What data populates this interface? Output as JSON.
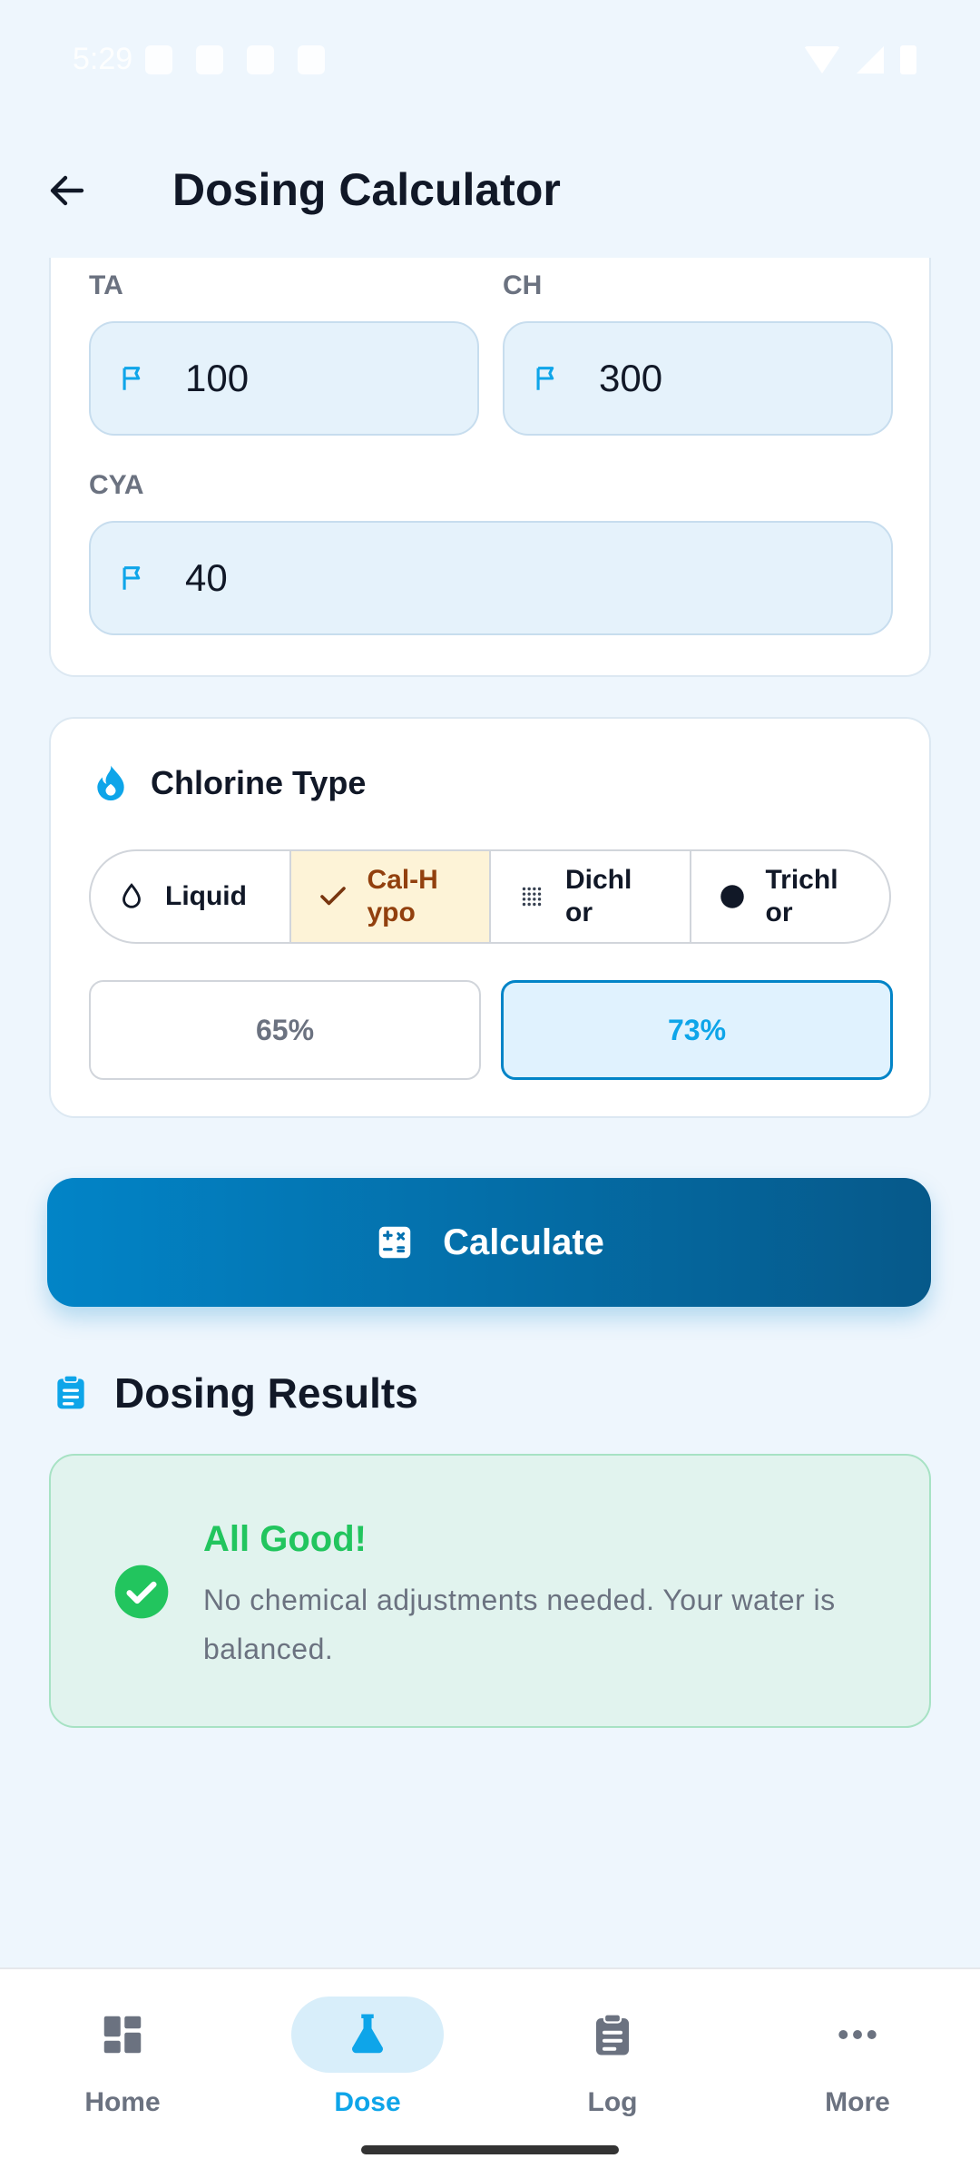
{
  "status_bar": {
    "time": "5:29"
  },
  "header": {
    "title": "Dosing Calculator"
  },
  "inputs": {
    "ta": {
      "label": "TA",
      "value": "100"
    },
    "ch": {
      "label": "CH",
      "value": "300"
    },
    "cya": {
      "label": "CYA",
      "value": "40"
    }
  },
  "chlorine": {
    "title": "Chlorine Type",
    "types": [
      {
        "label": "Liquid",
        "icon": "drop-icon",
        "selected": false
      },
      {
        "label": "Cal-Hypo",
        "icon": "check-icon",
        "selected": true
      },
      {
        "label": "Dichlor",
        "icon": "dots-grid-icon",
        "selected": false
      },
      {
        "label": "Trichlor",
        "icon": "circle-icon",
        "selected": false
      }
    ],
    "strengths": [
      {
        "label": "65%",
        "selected": false
      },
      {
        "label": "73%",
        "selected": true
      }
    ]
  },
  "calculate": {
    "label": "Calculate"
  },
  "results": {
    "title": "Dosing Results",
    "status_title": "All Good!",
    "message": "No chemical adjustments needed. Your water is balanced."
  },
  "nav": [
    {
      "label": "Home",
      "icon": "dashboard-icon",
      "active": false
    },
    {
      "label": "Dose",
      "icon": "flask-icon",
      "active": true
    },
    {
      "label": "Log",
      "icon": "clipboard-icon",
      "active": false
    },
    {
      "label": "More",
      "icon": "more-dots-icon",
      "active": false
    }
  ],
  "colors": {
    "accent": "#0EA5E9",
    "success": "#22C55E",
    "selected_bg": "#FDF3D7"
  }
}
